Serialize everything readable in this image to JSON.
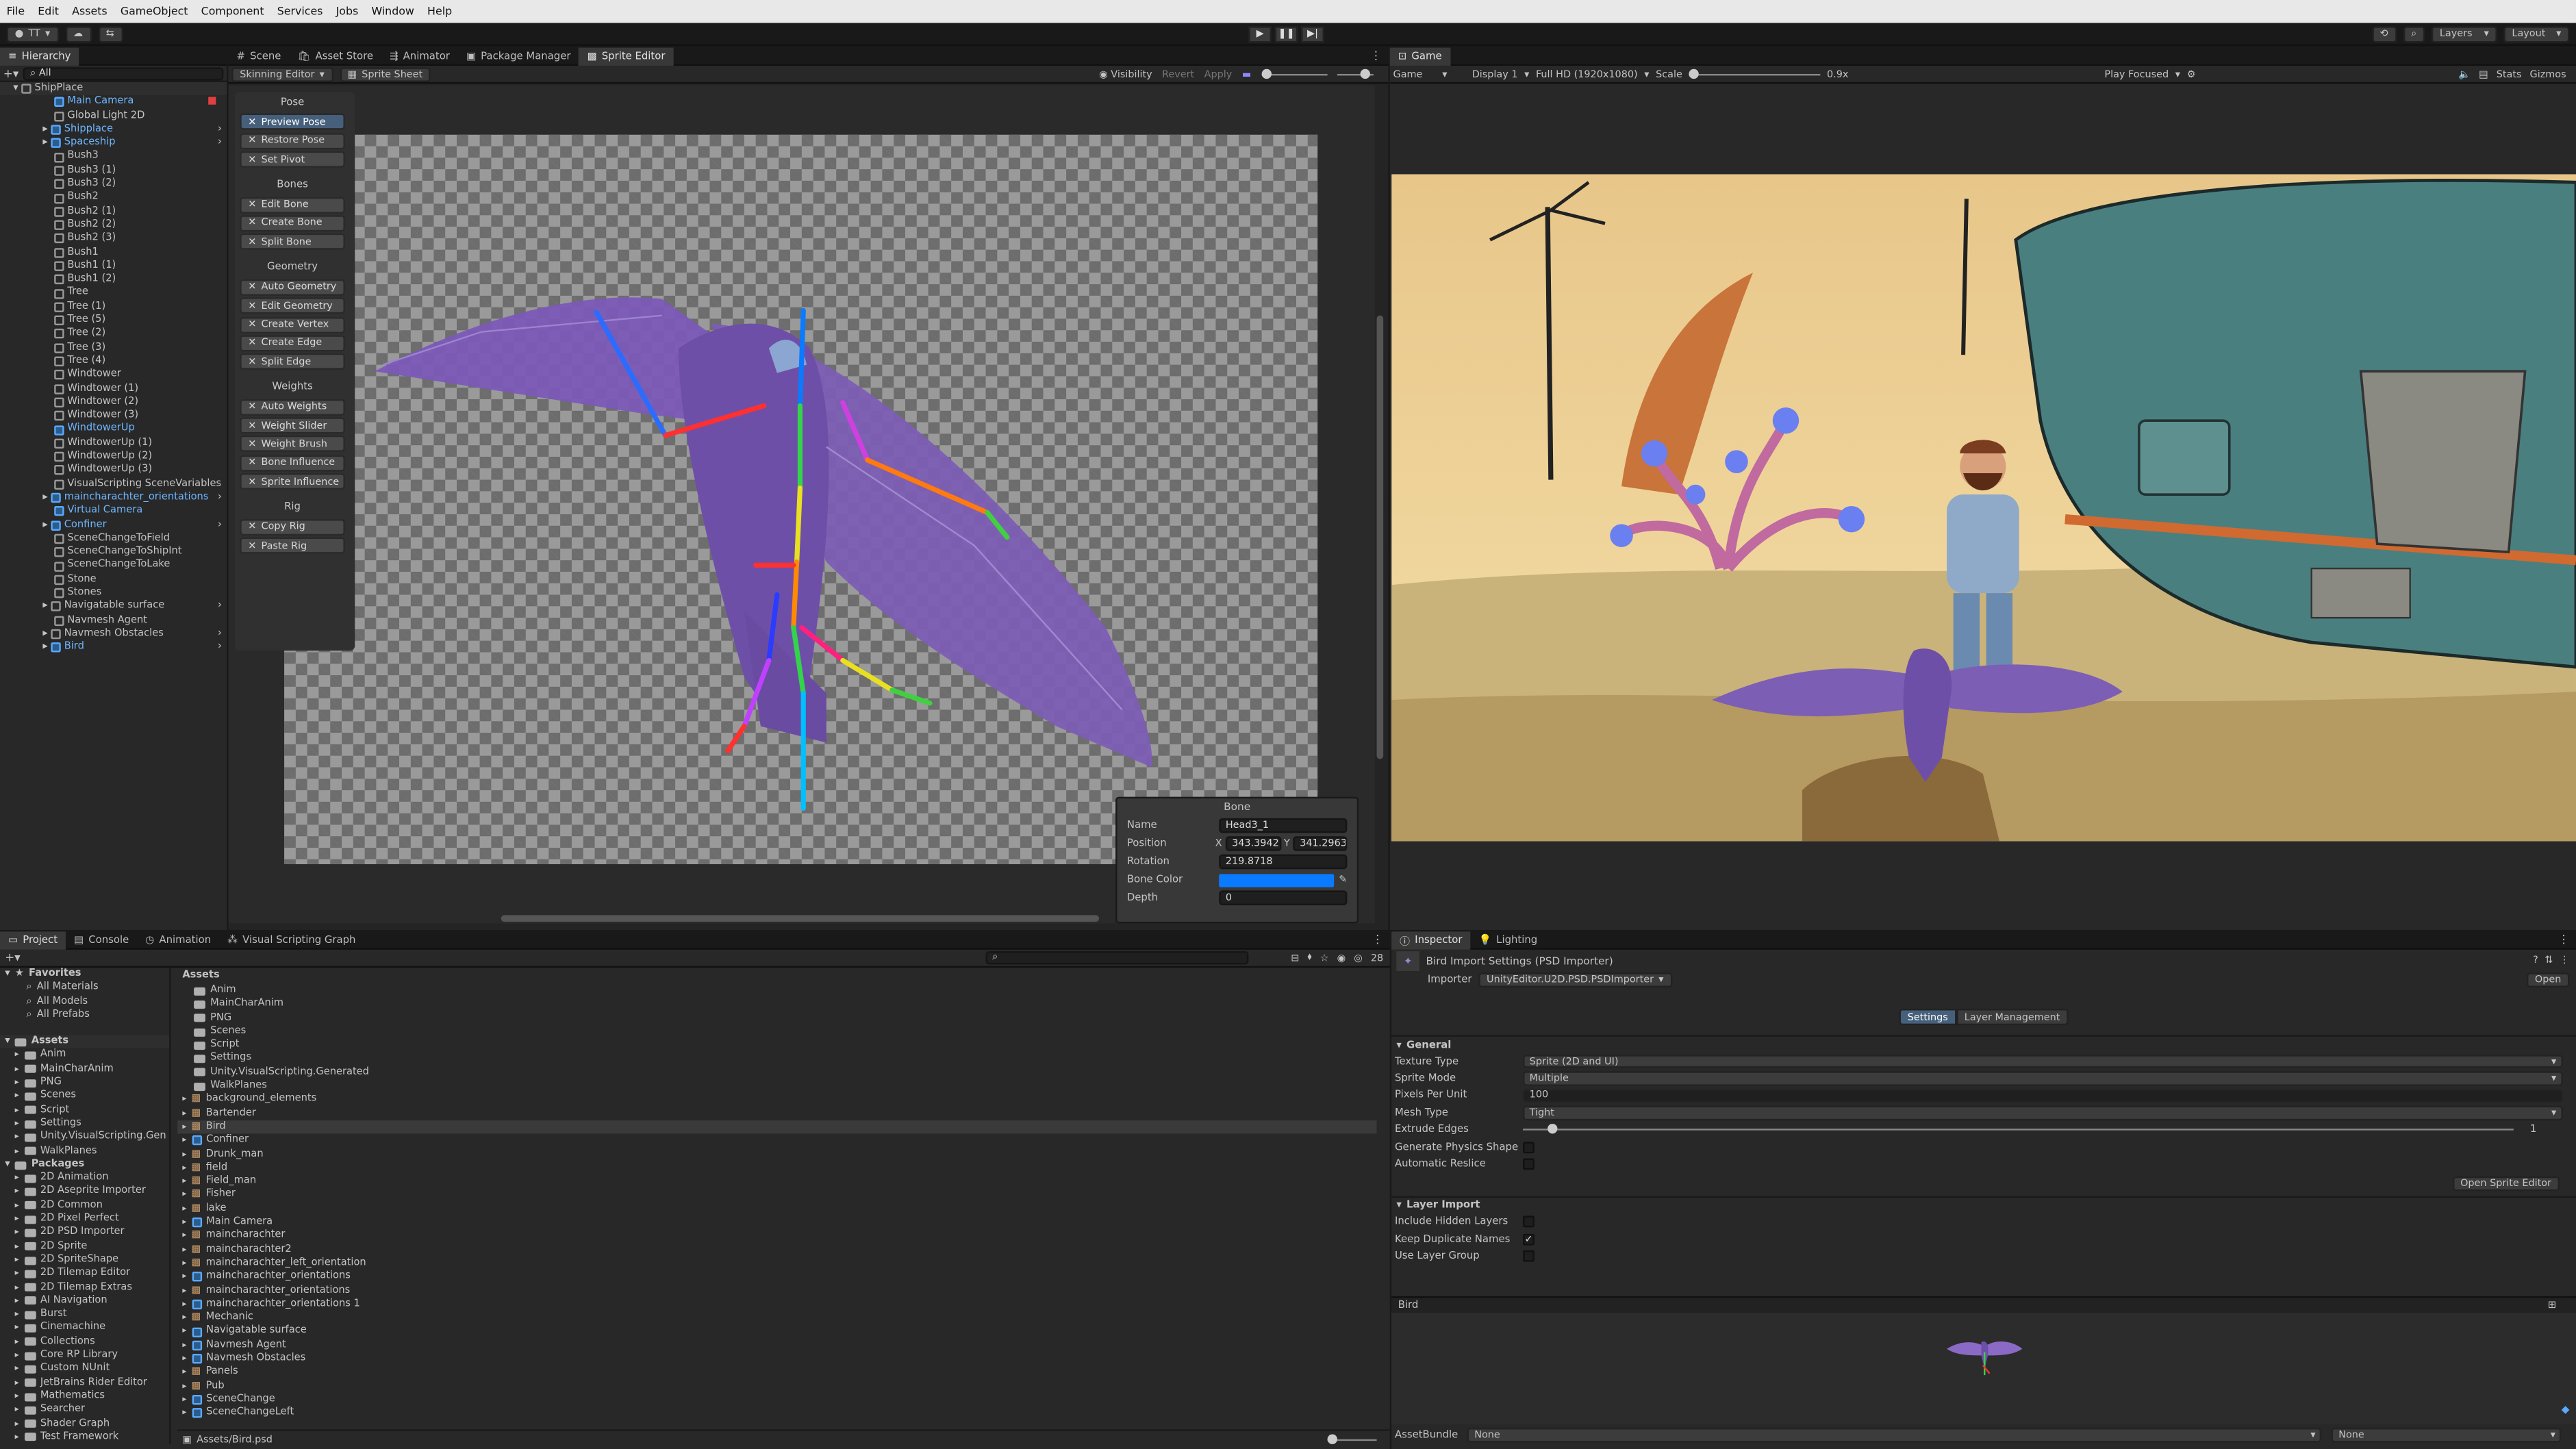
{
  "menu": [
    "File",
    "Edit",
    "Assets",
    "GameObject",
    "Component",
    "Services",
    "Jobs",
    "Window",
    "Help"
  ],
  "toolbar": {
    "account": "TT",
    "layers": "Layers",
    "layout": "Layout"
  },
  "hierarchy": {
    "tab": "Hierarchy",
    "search": "All",
    "root": "ShipPlace",
    "items": [
      {
        "label": "Main Camera",
        "blue": true
      },
      {
        "label": "Global Light 2D"
      },
      {
        "label": "Shipplace",
        "blue": true,
        "arrow": true
      },
      {
        "label": "Spaceship",
        "blue": true,
        "arrow": true
      },
      {
        "label": "Bush3"
      },
      {
        "label": "Bush3 (1)"
      },
      {
        "label": "Bush3 (2)"
      },
      {
        "label": "Bush2"
      },
      {
        "label": "Bush2 (1)"
      },
      {
        "label": "Bush2 (2)"
      },
      {
        "label": "Bush2 (3)"
      },
      {
        "label": "Bush1"
      },
      {
        "label": "Bush1 (1)"
      },
      {
        "label": "Bush1 (2)"
      },
      {
        "label": "Tree"
      },
      {
        "label": "Tree (1)"
      },
      {
        "label": "Tree (5)"
      },
      {
        "label": "Tree (2)"
      },
      {
        "label": "Tree (3)"
      },
      {
        "label": "Tree (4)"
      },
      {
        "label": "Windtower"
      },
      {
        "label": "Windtower (1)"
      },
      {
        "label": "Windtower (2)"
      },
      {
        "label": "Windtower (3)"
      },
      {
        "label": "WindtowerUp",
        "blue": true
      },
      {
        "label": "WindtowerUp (1)"
      },
      {
        "label": "WindtowerUp (2)"
      },
      {
        "label": "WindtowerUp (3)"
      },
      {
        "label": "VisualScripting SceneVariables"
      },
      {
        "label": "maincharachter_orientations",
        "blue": true,
        "arrow": true
      },
      {
        "label": "Virtual Camera",
        "blue": true
      },
      {
        "label": "Confiner",
        "blue": true,
        "arrow": true
      },
      {
        "label": "SceneChangeToField"
      },
      {
        "label": "SceneChangeToShipInt"
      },
      {
        "label": "SceneChangeToLake"
      },
      {
        "label": "Stone"
      },
      {
        "label": "Stones"
      },
      {
        "label": "Navigatable surface",
        "arrow": true
      },
      {
        "label": "Navmesh Agent"
      },
      {
        "label": "Navmesh Obstacles",
        "arrow": true
      },
      {
        "label": "Bird",
        "blue": true,
        "arrow": true
      }
    ]
  },
  "center_tabs": [
    "Scene",
    "Asset Store",
    "Animator",
    "Package Manager",
    "Sprite Editor"
  ],
  "sprite_editor": {
    "mode": "Skinning Editor",
    "sprite_sheet": "Sprite Sheet",
    "visibility": "Visibility",
    "revert": "Revert",
    "apply": "Apply",
    "groups": [
      {
        "title": "Pose",
        "buttons": [
          "Preview Pose",
          "Restore Pose",
          "Set Pivot"
        ],
        "active": 0
      },
      {
        "title": "Bones",
        "buttons": [
          "Edit Bone",
          "Create Bone",
          "Split Bone"
        ]
      },
      {
        "title": "Geometry",
        "buttons": [
          "Auto Geometry",
          "Edit Geometry",
          "Create Vertex",
          "Create Edge",
          "Split Edge"
        ]
      },
      {
        "title": "Weights",
        "buttons": [
          "Auto Weights",
          "Weight Slider",
          "Weight Brush",
          "Bone Influence",
          "Sprite Influence"
        ]
      },
      {
        "title": "Rig",
        "buttons": [
          "Copy Rig",
          "Paste Rig"
        ]
      }
    ],
    "bone": {
      "title": "Bone",
      "name_label": "Name",
      "name": "Head3_1",
      "position_label": "Position",
      "x": "343.3942",
      "y": "341.2963",
      "rotation_label": "Rotation",
      "rotation": "219.8718",
      "color_label": "Bone Color",
      "bone_color": "#0a7aff",
      "depth_label": "Depth",
      "depth": "0"
    }
  },
  "game": {
    "tab": "Game",
    "mode": "Game",
    "display": "Display 1",
    "resolution": "Full HD (1920x1080)",
    "scale_label": "Scale",
    "scale": "0.9x",
    "play_mode": "Play Focused",
    "stats": "Stats",
    "gizmos": "Gizmos"
  },
  "bottom_tabs": [
    "Project",
    "Console",
    "Animation",
    "Visual Scripting Graph"
  ],
  "project": {
    "favorites_title": "Favorites",
    "favorites": [
      "All Materials",
      "All Models",
      "All Prefabs"
    ],
    "assets_title": "Assets",
    "assets_tree": [
      "Anim",
      "MainCharAnim",
      "PNG",
      "Scenes",
      "Script",
      "Settings",
      "Unity.VisualScripting.Gen",
      "WalkPlanes"
    ],
    "packages_title": "Packages",
    "packages": [
      "2D Animation",
      "2D Aseprite Importer",
      "2D Common",
      "2D Pixel Perfect",
      "2D PSD Importer",
      "2D Sprite",
      "2D SpriteShape",
      "2D Tilemap Editor",
      "2D Tilemap Extras",
      "AI Navigation",
      "Burst",
      "Cinemachine",
      "Collections",
      "Core RP Library",
      "Custom NUnit",
      "JetBrains Rider Editor",
      "Mathematics",
      "Searcher",
      "Shader Graph",
      "Test Framework"
    ],
    "breadcrumb": "Assets",
    "count": "28",
    "files": [
      {
        "label": "Anim",
        "kind": "folder"
      },
      {
        "label": "MainCharAnim",
        "kind": "folder"
      },
      {
        "label": "PNG",
        "kind": "folder"
      },
      {
        "label": "Scenes",
        "kind": "folder"
      },
      {
        "label": "Script",
        "kind": "folder"
      },
      {
        "label": "Settings",
        "kind": "folder"
      },
      {
        "label": "Unity.VisualScripting.Generated",
        "kind": "folder"
      },
      {
        "label": "WalkPlanes",
        "kind": "folder"
      },
      {
        "label": "background_elements",
        "kind": "asset"
      },
      {
        "label": "Bartender",
        "kind": "asset"
      },
      {
        "label": "Bird",
        "kind": "asset",
        "selected": true
      },
      {
        "label": "Confiner",
        "kind": "prefab"
      },
      {
        "label": "Drunk_man",
        "kind": "asset"
      },
      {
        "label": "field",
        "kind": "asset"
      },
      {
        "label": "Field_man",
        "kind": "asset"
      },
      {
        "label": "Fisher",
        "kind": "asset"
      },
      {
        "label": "lake",
        "kind": "asset"
      },
      {
        "label": "Main Camera",
        "kind": "prefab"
      },
      {
        "label": "maincharachter",
        "kind": "asset"
      },
      {
        "label": "maincharachter2",
        "kind": "asset"
      },
      {
        "label": "maincharachter_left_orientation",
        "kind": "asset"
      },
      {
        "label": "maincharachter_orientations",
        "kind": "prefab"
      },
      {
        "label": "maincharachter_orientations",
        "kind": "asset"
      },
      {
        "label": "maincharachter_orientations 1",
        "kind": "prefab"
      },
      {
        "label": "Mechanic",
        "kind": "asset"
      },
      {
        "label": "Navigatable surface",
        "kind": "prefab"
      },
      {
        "label": "Navmesh Agent",
        "kind": "prefab"
      },
      {
        "label": "Navmesh Obstacles",
        "kind": "prefab"
      },
      {
        "label": "Panels",
        "kind": "asset"
      },
      {
        "label": "Pub",
        "kind": "asset"
      },
      {
        "label": "SceneChange",
        "kind": "prefab"
      },
      {
        "label": "SceneChangeLeft",
        "kind": "prefab"
      }
    ],
    "status_path": "Assets/Bird.psd"
  },
  "inspector": {
    "tabs": [
      "Inspector",
      "Lighting"
    ],
    "title": "Bird Import Settings (PSD Importer)",
    "importer_label": "Importer",
    "importer": "UnityEditor.U2D.PSD.PSDImporter",
    "open": "Open",
    "subtabs": [
      "Settings",
      "Layer Management"
    ],
    "general": "General",
    "fields": [
      {
        "label": "Texture Type",
        "value": "Sprite (2D and UI)",
        "type": "dropdown"
      },
      {
        "label": "Sprite Mode",
        "value": "Multiple",
        "type": "dropdown"
      },
      {
        "label": "Pixels Per Unit",
        "value": "100",
        "type": "text"
      },
      {
        "label": "Mesh Type",
        "value": "Tight",
        "type": "dropdown"
      },
      {
        "label": "Extrude Edges",
        "value": "1",
        "type": "slider"
      },
      {
        "label": "Generate Physics Shape",
        "value": "",
        "type": "check"
      },
      {
        "label": "Automatic Reslice",
        "value": "",
        "type": "check"
      }
    ],
    "open_sprite_editor": "Open Sprite Editor",
    "layer_import": "Layer Import",
    "layer_fields": [
      {
        "label": "Include Hidden Layers",
        "checked": false
      },
      {
        "label": "Keep Duplicate Names",
        "checked": true
      },
      {
        "label": "Use Layer Group",
        "checked": false
      }
    ],
    "preview_title": "Bird",
    "assetbundle_label": "AssetBundle",
    "assetbundle": "None",
    "assetbundle_variant": "None"
  }
}
